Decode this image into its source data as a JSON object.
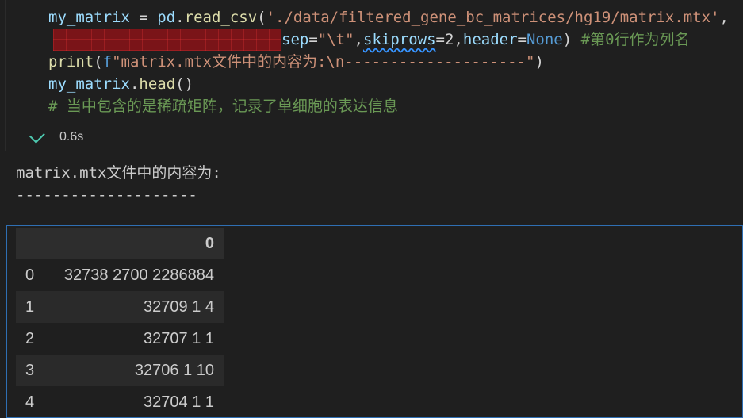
{
  "code": {
    "line1": {
      "var": "my_matrix",
      "op": " = ",
      "obj": "pd",
      "dot": ".",
      "fn": "read_csv",
      "open": "(",
      "path": "'./data/filtered_gene_bc_matrices/hg19/matrix.mtx'",
      "comma": ","
    },
    "line2": {
      "sep_kw": "sep",
      "sep_eq": "=",
      "sep_val": "\"\\t\"",
      "c1": ",",
      "skip_kw": "skiprows",
      "skip_eq": "=",
      "skip_val": "2",
      "c2": ",",
      "header_kw": "header",
      "header_eq": "=",
      "header_val": "None",
      "close": ")",
      "comment": " #第0行作为列名"
    },
    "line3": {
      "fn": "print",
      "open": "(",
      "fprefix": "f",
      "str": "\"matrix.mtx文件中的内容为:\\n--------------------\"",
      "close": ")"
    },
    "line4": {
      "var": "my_matrix",
      "dot": ".",
      "fn": "head",
      "parens": "()"
    },
    "line5": {
      "comment": "# 当中包含的是稀疏矩阵，记录了单细胞的表达信息"
    }
  },
  "status": {
    "duration": "0.6s",
    "icon": "check-icon"
  },
  "output": {
    "line1": "matrix.mtx文件中的内容为:",
    "line2": "--------------------"
  },
  "table": {
    "header": {
      "index": "",
      "col": "0"
    },
    "rows": [
      {
        "index": "0",
        "value": "32738 2700 2286884"
      },
      {
        "index": "1",
        "value": "32709 1 4"
      },
      {
        "index": "2",
        "value": "32707 1 1"
      },
      {
        "index": "3",
        "value": "32706 1 10"
      },
      {
        "index": "4",
        "value": "32704 1 1"
      }
    ]
  },
  "colors": {
    "background": "#1f1f1f",
    "success": "#4ec9b0",
    "frame": "#2f6fb3"
  }
}
